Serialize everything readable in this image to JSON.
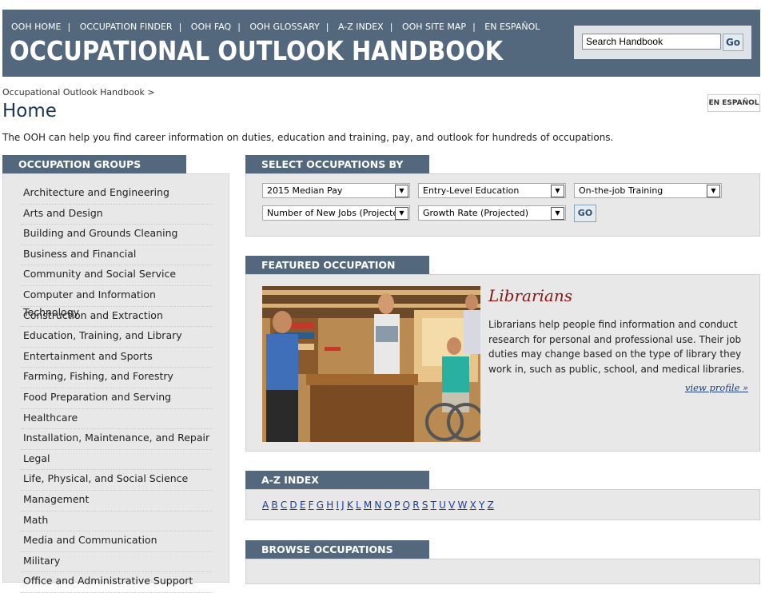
{
  "header": {
    "nav": [
      "OOH HOME",
      "OCCUPATION FINDER",
      "OOH FAQ",
      "OOH GLOSSARY",
      "A-Z INDEX",
      "OOH SITE MAP",
      "EN ESPAÑOL"
    ],
    "site_title": "OCCUPATIONAL OUTLOOK HANDBOOK",
    "search_value": "Search Handbook",
    "search_button": "Go"
  },
  "breadcrumb": "Occupational Outlook Handbook >",
  "page_title": "Home",
  "espanol_button": "EN ESPAÑOL",
  "intro": "The OOH can help you find career information on duties, education and training, pay, and outlook for hundreds of occupations.",
  "groups": {
    "heading": "OCCUPATION GROUPS",
    "items": [
      "Architecture and Engineering",
      "Arts and Design",
      "Building and Grounds Cleaning",
      "Business and Financial",
      "Community and Social Service",
      "Computer and Information Technology",
      "Construction and Extraction",
      "Education, Training, and Library",
      "Entertainment and Sports",
      "Farming, Fishing, and Forestry",
      "Food Preparation and Serving",
      "Healthcare",
      "Installation, Maintenance, and Repair",
      "Legal",
      "Life, Physical, and Social Science",
      "Management",
      "Math",
      "Media and Communication",
      "Military",
      "Office and Administrative Support"
    ]
  },
  "select_by": {
    "heading": "SELECT OCCUPATIONS BY",
    "selects": [
      "2015 Median Pay",
      "Entry-Level Education",
      "On-the-job Training",
      "Number of New Jobs (Projected)",
      "Growth Rate (Projected)"
    ],
    "go": "GO"
  },
  "featured": {
    "heading": "FEATURED OCCUPATION",
    "title": "Librarians",
    "description": "Librarians help people find information and conduct research for personal and professional use. Their job duties may change based on the type of library they work in, such as public, school, and medical libraries.",
    "link": "view profile »"
  },
  "az": {
    "heading": "A-Z INDEX",
    "letters": [
      "A",
      "B",
      "C",
      "D",
      "E",
      "F",
      "G",
      "H",
      "I",
      "J",
      "K",
      "L",
      "M",
      "N",
      "O",
      "P",
      "Q",
      "R",
      "S",
      "T",
      "U",
      "V",
      "W",
      "X",
      "Y",
      "Z"
    ]
  },
  "browse": {
    "heading": "BROWSE OCCUPATIONS"
  }
}
